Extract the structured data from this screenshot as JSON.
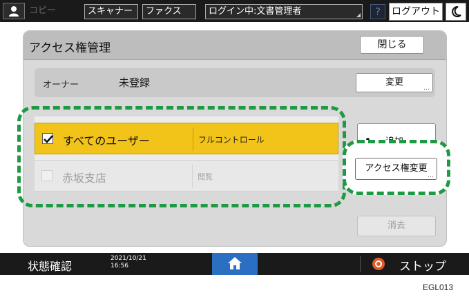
{
  "topbar": {
    "tabs": [
      {
        "label": "コピー",
        "enabled": false
      },
      {
        "label": "スキャナー",
        "enabled": true
      },
      {
        "label": "ファクス",
        "enabled": true
      }
    ],
    "login_status": "ログイン中:文書管理者",
    "help_label": "?",
    "logout_label": "ログアウト"
  },
  "dialog": {
    "title": "アクセス権管理",
    "close_label": "閉じる",
    "owner": {
      "label": "オーナー",
      "value": "未登録",
      "change_label": "変更"
    },
    "entries": [
      {
        "name": "すべてのユーザー",
        "permission": "フルコントロール",
        "checked": true
      },
      {
        "name": "赤坂支店",
        "permission": "閲覧",
        "checked": false
      }
    ],
    "buttons": {
      "add_label": "追加",
      "access_change_label": "アクセス権変更",
      "delete_label": "消去"
    }
  },
  "statusbar": {
    "status_label": "状態確認",
    "date": "2021/10/21",
    "time": "16:56",
    "stop_label": "ストップ"
  },
  "figure_code": "EGL013",
  "colors": {
    "selected_row": "#f2c318",
    "callout": "#1f9a44",
    "home": "#2b6fc2",
    "stop_icon": "#e05a28"
  },
  "icons": {
    "user": "user-icon",
    "moon": "moon-icon",
    "home": "home-icon",
    "stop": "stop-icon",
    "check": "check-icon"
  }
}
